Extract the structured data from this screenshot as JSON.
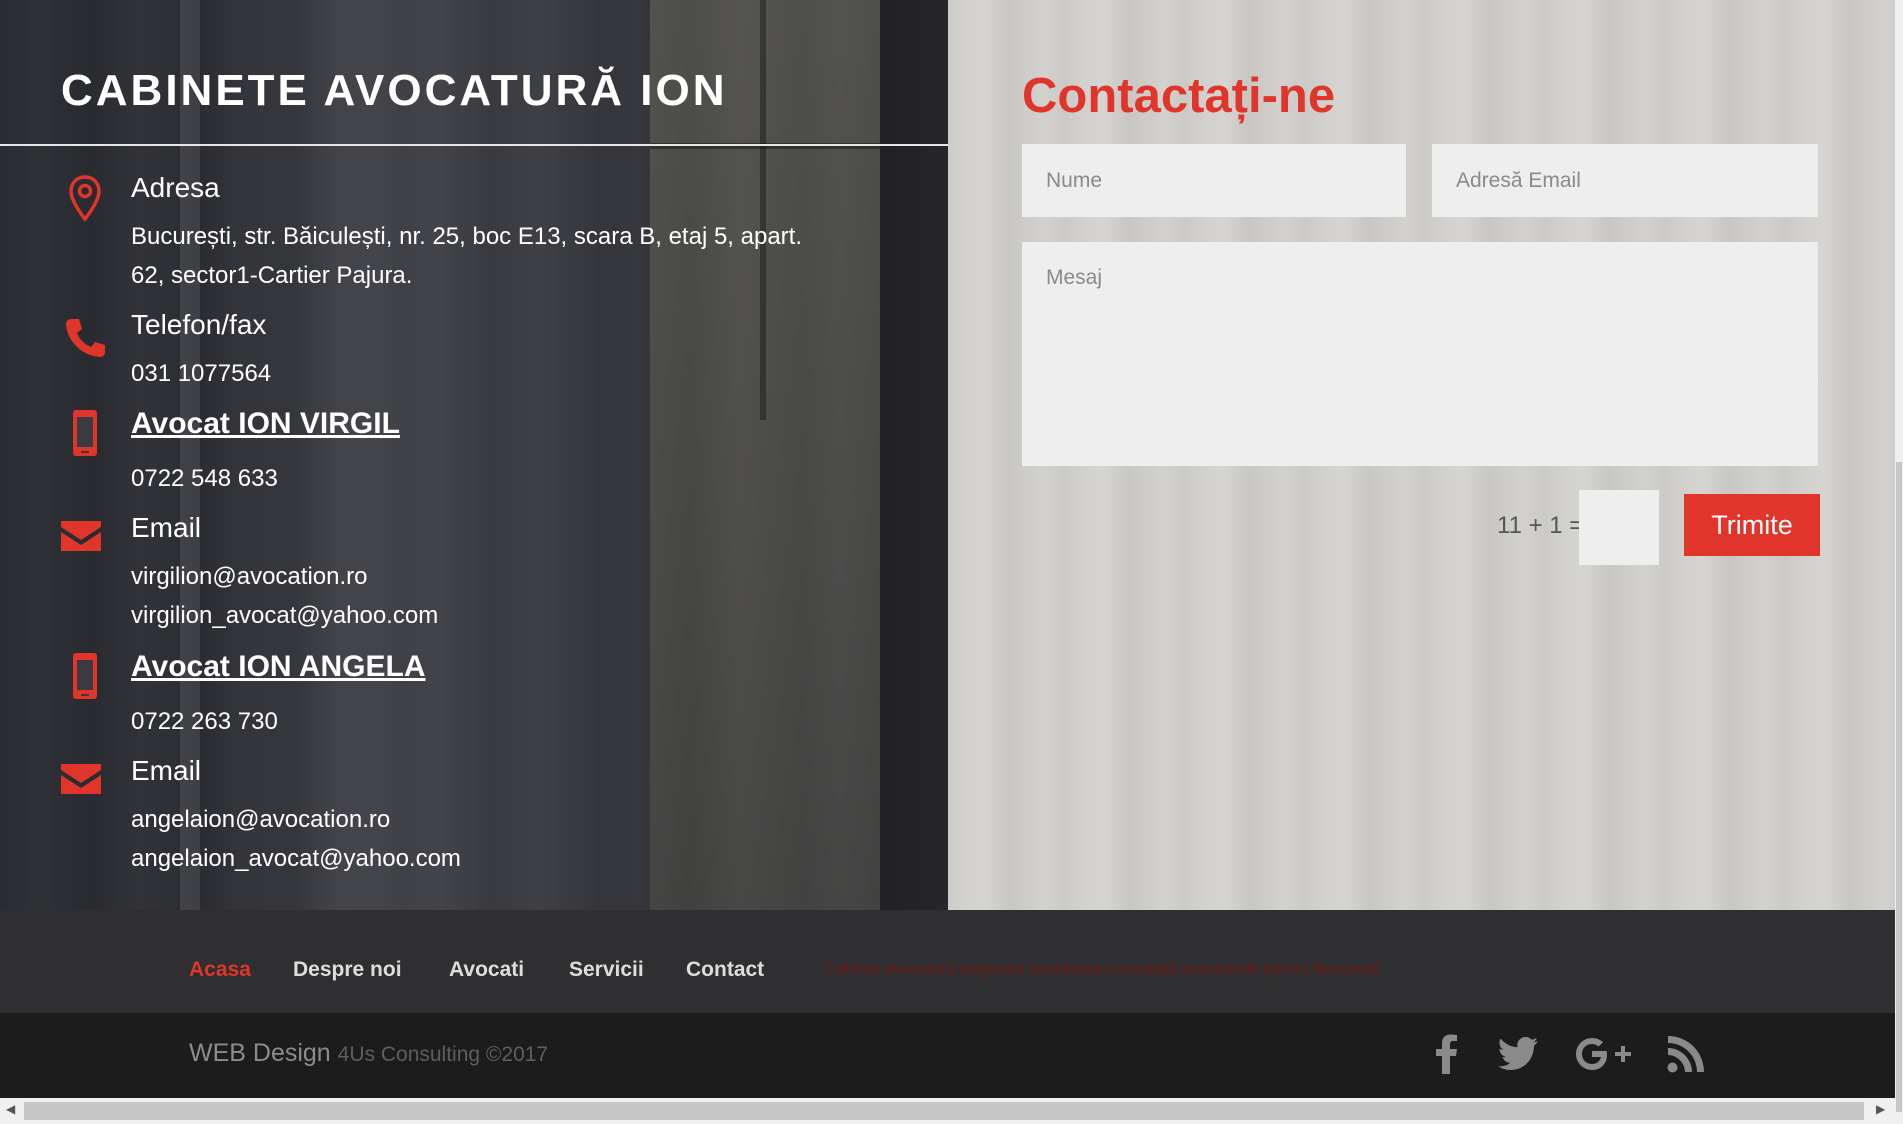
{
  "header": {
    "site_title": "CABINETE AVOCATURĂ ION"
  },
  "info": {
    "address_label": "Adresa",
    "address_line1": "București, str. Băiculești, nr. 25, boc E13, scara B, etaj 5, apart.",
    "address_line2": "62, sector1-Cartier Pajura.",
    "phone_label": "Telefon/fax",
    "phone_value": "031 1077564",
    "lawyer1_name": "Avocat ION VIRGIL",
    "lawyer1_phone": "0722 548 633",
    "email1_label": "Email",
    "email1_a": "virgilion@avocation.ro",
    "email1_b": "virgilion_avocat@yahoo.com",
    "lawyer2_name": "Avocat ION ANGELA",
    "lawyer2_phone": "0722 263 730",
    "email2_label": "Email",
    "email2_a": "angelaion@avocation.ro",
    "email2_b": "angelaion_avocat@yahoo.com"
  },
  "contact_form": {
    "title": "Contactați-ne",
    "name_placeholder": "Nume",
    "email_placeholder": "Adresă Email",
    "message_placeholder": "Mesaj",
    "captcha_question": "11 + 1 =",
    "submit_label": "Trimite"
  },
  "footer_nav": {
    "items": [
      "Acasa",
      "Despre noi",
      "Avocati",
      "Servicii",
      "Contact"
    ],
    "active": "Acasa",
    "ticker": "Cabinet avocatura asiguram acordarea consultatii avocentele pentru Bucuresti"
  },
  "bottom": {
    "credit_main": "WEB Design",
    "credit_small": "4Us Consulting ©2017",
    "social_icons": [
      "facebook-icon",
      "twitter-icon",
      "google-plus-icon",
      "rss-icon"
    ]
  },
  "colors": {
    "accent": "#e0352b",
    "footer_bg": "#2f2f31",
    "bottom_bg": "#1c1c1d"
  }
}
